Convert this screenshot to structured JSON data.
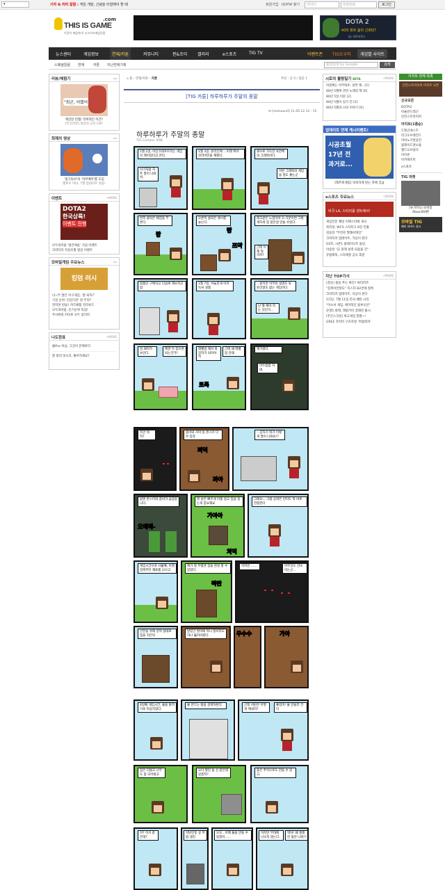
{
  "topbar": {
    "select_label": "",
    "notice_brand": "기자 & 리터 칼럼 :",
    "notice_text": "게임 개발, 신념을 타협해야 할 때",
    "links": "회원가입 · ID/PW 찾기",
    "id_placeholder": "아이디",
    "pw_placeholder": "비밀번호",
    "login_label": "로그인"
  },
  "logo": {
    "com": ".com",
    "name": "THIS IS GAME",
    "tagline": "이것이 게임이다! 디스이즈게임닷컴"
  },
  "ad_right": {
    "title": "DOTA 2",
    "sub": "AOS 장르 붐의 신호탄?",
    "credit": "by 게이버로스"
  },
  "nav": {
    "items": [
      "뉴스센터",
      "게임정보",
      "연재/카툰",
      "커뮤니티",
      "핀&조이",
      "갤러리",
      "e스포츠",
      "TIG TV"
    ],
    "right": [
      "이벤트존",
      "TIG도우미",
      "게임별 사이트"
    ]
  },
  "subnav": {
    "items": [
      "스페셜칼럼",
      "연재",
      "카툰",
      "지난연재기획"
    ],
    "search_placeholder": "통합검색 by Google",
    "search_btn": "검색"
  },
  "left": {
    "review": {
      "title": "리뷰/체험기",
      "bubble": "\"최군, 어땠어?\"",
      "caption1": "액션만 만렙! 작위적인 이건?",
      "caption2": "[트크리뷰] 최강의 군단 CBT"
    },
    "video": {
      "title": "회제의 영상",
      "caption1": "'랑그릿사'의 '카르메아'를 도입",
      "caption2": "헬로우 마녀, 7월 업데이트 적용!"
    },
    "event": {
      "title": "이벤트",
      "art_t1": "DOTA2",
      "art_t2": "한국상륙!",
      "art_t3": "이벤트 진행",
      "items": [
        "모두의마블 '벗은애송' 기념 이벤트",
        "크리티카 지성초월 댓글 이벤트"
      ]
    },
    "mobile": {
      "title": "모바일게임 주요뉴스",
      "art": "킹덤 러시",
      "items": [
        "너~무 많은 아구게임, '잘 되자?'",
        "구글 순위 '신입기관' 뭔 무엇?",
        "현지면 번들? 카드배틀 언리쉬드",
        "모두의마블, 인기순위 독점!",
        "주사위와 카이로 모두 굴러라"
      ]
    },
    "qa": {
      "title": "나도한표",
      "items": [
        "불lfvs 비넘, 그것이 문제로다",
        "잘 밖의 빗소리, 좋아하세요?"
      ]
    }
  },
  "article": {
    "crumb_home": "홈",
    "crumb_1": "연재/카툰",
    "crumb_2": "카툰",
    "replies": "추천 : 글 0 / 댓글 1",
    "title": "[TIG 카툰] 하루하루가 주말의 종말",
    "meta": "[onesound]   11.05.12 12 : 15",
    "comic_title": "하루하루가 주말의 종말",
    "comic_sub": "TIG Cartoon #68"
  },
  "comic": {
    "b1": "1월 2일, 마인크래프트라는 게임이 제이밌다고 한다.",
    "b2": "아기처럼 자주 말이 나와서,",
    "b3": "1월 3일, 온라인에 ...이래 튀어 코리머전을 해봤다.",
    "b4": "큐브로 가득한 육면체의 그래픽이다.",
    "b5": "이런 그래픽의 게임을 정도 좋는군",
    "b6": "왼쪽 클릭은 채집을 부른다.",
    "b7": "오른쪽 클릭은 큐브를 놓는다.",
    "b8": "레고같은 느낌이야 3~5분이면 그렇게하게 집 앞은걸 만들 수있다.",
    "b9": "근데 이제 뭐 하지?",
    "b10": "정품만 구매하고 다음에 해보자고 함",
    "b11": "1월 7일, 서늘한게 아카득서 설렘",
    "b12": "...원치만 아무런 설명도 튜토리얼도 없는 게임이다.",
    "b13": "난 뭘 해야 하는 것인가...",
    "b14": "잉 돼지가 보인다.",
    "b15": "제경 막 잡으면 되는건가?",
    "b16": "레벨업 해서 최강자가 되어야지",
    "b17": "근데 왜 레벨업 안돼",
    "b18": "해가졌다.",
    "b19": "어두컴컴 하네.",
    "b20": "저건 뭐지?",
    "b21": "좀비와 거미 등 몬스터 다수 등장",
    "b22": "...깁자기 뭐가 이렇게 많이 나와요!?",
    "b23": "밤엔 몬스터와 좀비가 급증합니다.",
    "b24": "컷 낮은 빠르게 터를 잡고 집을 짓는게 중요해요",
    "b25": "그래요... 그럼 공략은 인터도 뭐 바로 전합한다",
    "b26": "게임시간으로 사흘째, 이젠 일찍부터 재료를 모으고",
    "b27": "해가 질 무렵엔 집을 완성 할 수 있었다.",
    "b28": "하지만 ......",
    "b29": "아무것도 안보이는군...",
    "b30": "안전을 위해 일찍 형태로 집을 지은탓",
    "b31": "날있긴 말이에 하니 창이라도 하나 뚫어야겠다.",
    "b32": "4일째 게임시간, 불을 밝히기로 마음먹었다.",
    "b33": "불 만드는 법을 검색하본다.",
    "b34": "근데 석탄은 어떻게 캐내지?",
    "b35": "좋았어! 불 만들러 간다",
    "b36": "집은 더웠고 나무도 좀 모아둿고",
    "b37": "오다 봤던 돌 신 같은데 있겠지?",
    "b38": "돌은 추억으로도 만들 수 있고,",
    "b39": "어? 이거 같은데?",
    "b40": "석탄인듯 싶 저럼 생김",
    "b41": "오오...이제 불을 만들 수 있겠어......",
    "b42": "하지만 부대에 나오지 않는다.",
    "b43": "뭐야! 왜 횡횡한 돌만 나와!?",
    "sfx1": "깡",
    "sfx2": "빵",
    "sfx3": "쯔악",
    "sfx4": "퍼억",
    "sfx5": "까아",
    "sfx6": "오에에-",
    "sfx7": "가아아",
    "sfx8": "쳐억",
    "sfx9": "짝짠",
    "sfx10": "우수수",
    "sfx11": "가아",
    "sfx12": "토톡"
  },
  "right": {
    "hot": {
      "title": "시로의 불량일기",
      "badge": "BETA",
      "items": [
        "어정쩌는 아키텍토, 방연 제...[5]",
        "80년 5월에 관한 노래의 책 [6]",
        "80년 5일 이뮨 [2]",
        "80년 5월이 있기 전 [2]",
        "80년 5월과 나의 이야기 [6]"
      ]
    },
    "update": {
      "title": "업데이트 연재 캐시이펜트!",
      "art1": "시공초월",
      "art2": "17년 전",
      "art3": "과거로...",
      "caption": "[레트로게임] 익숙하게 된는 자에 궁금"
    },
    "esports": {
      "title": "e스포츠 주요뉴스",
      "banner": "미국 LA, 스타리를 샌트에서!",
      "items": [
        "게임전문 채널 이매스티베 개국",
        "최지성, WCS 스타터그 8강 진출",
        "김동현 \"무진된 팔쾌서혀인\"",
        "크리티카 업데이트, 가상이 왼다",
        "GSTL 시즌1 플레이오프 돌입",
        "이승현 \"곧 원래 실력 되찾을 것\"",
        "유럽제적, 스타례절 공식 후원"
      ]
    },
    "top": {
      "title": "지난 TOP기사",
      "items": [
        "[경상] 블웅 추는 싸다? 싸이러즈",
        "\"잠피아전달도\" 지스타 B2큰에 접촉",
        "크리티카 업데이트, 각상이 온다",
        "도티2, 7월 11일 한국 베타 시작",
        "\"아소서 게임, 에마적인 블루오션\"",
        "운명5 화백, 레빌가이 골레먼 출시",
        "[주간스크린] 복고게임 열풍~!",
        "GREE 코리아 구조조정 '위협적자'"
      ]
    }
  },
  "far": {
    "hd": "아지트 전체 목록",
    "banner": "던전스트라이커 아지트 오픈",
    "new_title": "신규오픈",
    "new_items": [
      "DOTA2",
      "아슬란드레곤",
      "던전스트라이커"
    ],
    "list_title": "아지트(1종순)",
    "list_items": [
      "드래곤네스트",
      "리그오브레전드",
      "마비노기영웅전",
      "블레이드앤소울",
      "월드오브탱크",
      "아이온",
      "아키에이지"
    ],
    "esports_link": "e스포츠",
    "market": "TIG 마켓",
    "market_cap1": "[뉴가TIG] 모바일",
    "market_cap2": "Xbox360판",
    "mobile": "모바일 TIG",
    "mobile_sub": "베타 서비스 실시"
  },
  "colors": {
    "accent": "#3a8e2f",
    "nav_bg": "#2a2a2a",
    "title_blue": "#2a4a9a",
    "notice_red": "#dd0000"
  }
}
